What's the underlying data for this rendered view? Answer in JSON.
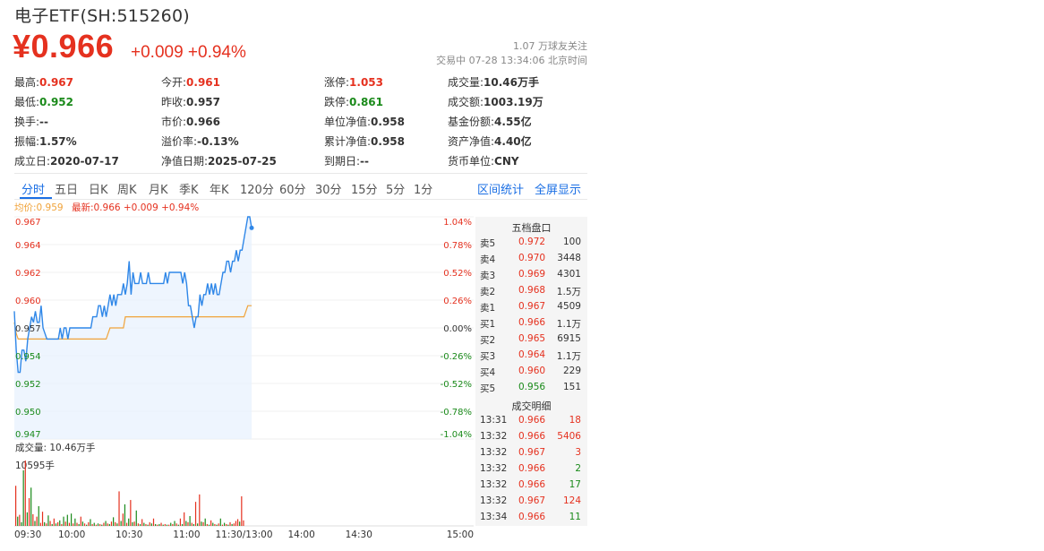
{
  "header": {
    "title": "电子ETF(SH:515260)",
    "price": "¥0.966",
    "change": "+0.009 +0.94%",
    "followers": "1.07 万球友关注",
    "status_time": "交易中 07-28 13:34:06 北京时间"
  },
  "stats": [
    {
      "label": "最高:",
      "value": "0.967",
      "color": "red"
    },
    {
      "label": "今开:",
      "value": "0.961",
      "color": "red"
    },
    {
      "label": "涨停:",
      "value": "1.053",
      "color": "red"
    },
    {
      "label": "成交量:",
      "value": "10.46万手",
      "color": ""
    },
    {
      "label": "最低:",
      "value": "0.952",
      "color": "green"
    },
    {
      "label": "昨收:",
      "value": "0.957",
      "color": ""
    },
    {
      "label": "跌停:",
      "value": "0.861",
      "color": "green"
    },
    {
      "label": "成交额:",
      "value": "1003.19万",
      "color": ""
    },
    {
      "label": "换手:",
      "value": "--",
      "color": ""
    },
    {
      "label": "市价:",
      "value": "0.966",
      "color": ""
    },
    {
      "label": "单位净值:",
      "value": "0.958",
      "color": ""
    },
    {
      "label": "基金份额:",
      "value": "4.55亿",
      "color": ""
    },
    {
      "label": "振幅:",
      "value": "1.57%",
      "color": ""
    },
    {
      "label": "溢价率:",
      "value": "-0.13%",
      "color": ""
    },
    {
      "label": "累计净值:",
      "value": "0.958",
      "color": ""
    },
    {
      "label": "资产净值:",
      "value": "4.40亿",
      "color": ""
    },
    {
      "label": "成立日:",
      "value": "2020-07-17",
      "color": ""
    },
    {
      "label": "净值日期:",
      "value": "2025-07-25",
      "color": ""
    },
    {
      "label": "到期日:",
      "value": "--",
      "color": ""
    },
    {
      "label": "货币单位:",
      "value": "CNY",
      "color": ""
    }
  ],
  "tabs": [
    "分时",
    "五日",
    "日K",
    "周K",
    "月K",
    "季K",
    "年K",
    "120分",
    "60分",
    "30分",
    "15分",
    "5分",
    "1分"
  ],
  "active_tab": "分时",
  "right_links": [
    "区间统计",
    "全屏显示"
  ],
  "legend": {
    "avg_label": "均价:0.959",
    "latest_label": "最新:0.966 +0.009 +0.94%"
  },
  "volume_panel": {
    "title": "成交量: 10.46万手",
    "max_label": "10595手"
  },
  "chart_data": {
    "type": "line",
    "prev_close": 0.957,
    "ylim": [
      0.947,
      0.967
    ],
    "y_ticks_left": [
      "0.967",
      "0.964",
      "0.962",
      "0.960",
      "0.957",
      "0.954",
      "0.952",
      "0.950",
      "0.947"
    ],
    "y_ticks_right": [
      "1.04%",
      "0.78%",
      "0.52%",
      "0.26%",
      "0.00%",
      "-0.26%",
      "-0.52%",
      "-0.78%",
      "-1.04%"
    ],
    "x_ticks": [
      "09:30",
      "10:00",
      "10:30",
      "11:00",
      "11:30/13:00",
      "14:00",
      "14:30",
      "15:00"
    ],
    "total_minutes": 240,
    "price_series": [
      0.9585,
      0.955,
      0.953,
      0.953,
      0.955,
      0.955,
      0.954,
      0.956,
      0.957,
      0.958,
      0.9575,
      0.9585,
      0.9575,
      0.9575,
      0.959,
      0.957,
      0.9565,
      0.956,
      0.956,
      0.956,
      0.956,
      0.956,
      0.956,
      0.956,
      0.957,
      0.956,
      0.957,
      0.957,
      0.956,
      0.957,
      0.957,
      0.957,
      0.957,
      0.957,
      0.957,
      0.957,
      0.957,
      0.957,
      0.957,
      0.957,
      0.957,
      0.958,
      0.958,
      0.958,
      0.959,
      0.959,
      0.958,
      0.959,
      0.958,
      0.959,
      0.96,
      0.959,
      0.96,
      0.959,
      0.96,
      0.96,
      0.96,
      0.961,
      0.96,
      0.961,
      0.963,
      0.96,
      0.962,
      0.961,
      0.961,
      0.961,
      0.962,
      0.961,
      0.961,
      0.961,
      0.962,
      0.961,
      0.961,
      0.961,
      0.961,
      0.961,
      0.961,
      0.961,
      0.961,
      0.962,
      0.961,
      0.962,
      0.962,
      0.962,
      0.962,
      0.962,
      0.962,
      0.962,
      0.961,
      0.962,
      0.961,
      0.959,
      0.959,
      0.958,
      0.957,
      0.958,
      0.958,
      0.96,
      0.959,
      0.96,
      0.96,
      0.961,
      0.96,
      0.961,
      0.96,
      0.961,
      0.96,
      0.96,
      0.961,
      0.962,
      0.962,
      0.963,
      0.963,
      0.962,
      0.963,
      0.963,
      0.964,
      0.963,
      0.964,
      0.964,
      0.965,
      0.966,
      0.967,
      0.967,
      0.966
    ],
    "avg_series": [
      0.9575,
      0.9565,
      0.956,
      0.956,
      0.956,
      0.956,
      0.956,
      0.956,
      0.956,
      0.956,
      0.956,
      0.956,
      0.956,
      0.956,
      0.956,
      0.956,
      0.956,
      0.956,
      0.956,
      0.956,
      0.956,
      0.956,
      0.956,
      0.956,
      0.956,
      0.956,
      0.956,
      0.956,
      0.956,
      0.956,
      0.956,
      0.956,
      0.956,
      0.956,
      0.956,
      0.956,
      0.956,
      0.956,
      0.956,
      0.956,
      0.956,
      0.956,
      0.956,
      0.956,
      0.956,
      0.956,
      0.956,
      0.956,
      0.956,
      0.9565,
      0.957,
      0.957,
      0.957,
      0.957,
      0.957,
      0.957,
      0.957,
      0.957,
      0.958,
      0.958,
      0.958,
      0.958,
      0.958,
      0.958,
      0.958,
      0.958,
      0.958,
      0.958,
      0.958,
      0.958,
      0.958,
      0.958,
      0.958,
      0.958,
      0.958,
      0.958,
      0.958,
      0.958,
      0.958,
      0.958,
      0.958,
      0.958,
      0.958,
      0.958,
      0.958,
      0.958,
      0.958,
      0.958,
      0.958,
      0.958,
      0.958,
      0.958,
      0.958,
      0.958,
      0.958,
      0.958,
      0.958,
      0.958,
      0.958,
      0.958,
      0.958,
      0.958,
      0.958,
      0.958,
      0.958,
      0.958,
      0.958,
      0.958,
      0.958,
      0.958,
      0.958,
      0.958,
      0.958,
      0.958,
      0.958,
      0.958,
      0.958,
      0.958,
      0.958,
      0.958,
      0.958,
      0.9585,
      0.959,
      0.959,
      0.959
    ],
    "volume_max": 10595,
    "volumes": [
      {
        "v": 6500,
        "up": true
      },
      {
        "v": 1500,
        "up": false
      },
      {
        "v": 1800,
        "up": true
      },
      {
        "v": 600,
        "up": false
      },
      {
        "v": 9000,
        "up": false
      },
      {
        "v": 10595,
        "up": true
      },
      {
        "v": 2200,
        "up": false
      },
      {
        "v": 4500,
        "up": true
      },
      {
        "v": 6200,
        "up": false
      },
      {
        "v": 1900,
        "up": true
      },
      {
        "v": 800,
        "up": false
      },
      {
        "v": 1500,
        "up": true
      },
      {
        "v": 3200,
        "up": false
      },
      {
        "v": 500,
        "up": true
      },
      {
        "v": 2300,
        "up": true
      },
      {
        "v": 600,
        "up": false
      },
      {
        "v": 400,
        "up": true
      },
      {
        "v": 1700,
        "up": false
      },
      {
        "v": 800,
        "up": true
      },
      {
        "v": 300,
        "up": false
      },
      {
        "v": 1200,
        "up": true
      },
      {
        "v": 400,
        "up": false
      },
      {
        "v": 600,
        "up": true
      },
      {
        "v": 900,
        "up": false
      },
      {
        "v": 300,
        "up": true
      },
      {
        "v": 1500,
        "up": false
      },
      {
        "v": 700,
        "up": true
      },
      {
        "v": 1800,
        "up": false
      },
      {
        "v": 500,
        "up": true
      },
      {
        "v": 2000,
        "up": false
      },
      {
        "v": 400,
        "up": true
      },
      {
        "v": 1200,
        "up": false
      },
      {
        "v": 500,
        "up": true
      },
      {
        "v": 300,
        "up": false
      },
      {
        "v": 1500,
        "up": true
      },
      {
        "v": 700,
        "up": false
      },
      {
        "v": 400,
        "up": true
      },
      {
        "v": 200,
        "up": false
      },
      {
        "v": 600,
        "up": true
      },
      {
        "v": 1100,
        "up": false
      },
      {
        "v": 300,
        "up": true
      },
      {
        "v": 500,
        "up": false
      },
      {
        "v": 200,
        "up": true
      },
      {
        "v": 400,
        "up": false
      },
      {
        "v": 300,
        "up": true
      },
      {
        "v": 200,
        "up": false
      },
      {
        "v": 500,
        "up": true
      },
      {
        "v": 800,
        "up": false
      },
      {
        "v": 400,
        "up": true
      },
      {
        "v": 300,
        "up": false
      },
      {
        "v": 700,
        "up": true
      },
      {
        "v": 1400,
        "up": false
      },
      {
        "v": 600,
        "up": true
      },
      {
        "v": 400,
        "up": false
      },
      {
        "v": 5600,
        "up": true
      },
      {
        "v": 800,
        "up": false
      },
      {
        "v": 2000,
        "up": true
      },
      {
        "v": 3500,
        "up": false
      },
      {
        "v": 500,
        "up": true
      },
      {
        "v": 1200,
        "up": false
      },
      {
        "v": 4200,
        "up": true
      },
      {
        "v": 600,
        "up": false
      },
      {
        "v": 700,
        "up": true
      },
      {
        "v": 2500,
        "up": false
      },
      {
        "v": 400,
        "up": true
      },
      {
        "v": 300,
        "up": false
      },
      {
        "v": 1100,
        "up": true
      },
      {
        "v": 500,
        "up": false
      },
      {
        "v": 300,
        "up": true
      },
      {
        "v": 200,
        "up": false
      },
      {
        "v": 600,
        "up": true
      },
      {
        "v": 400,
        "up": false
      },
      {
        "v": 1200,
        "up": true
      },
      {
        "v": 300,
        "up": false
      },
      {
        "v": 200,
        "up": true
      },
      {
        "v": 300,
        "up": false
      },
      {
        "v": 500,
        "up": true
      },
      {
        "v": 200,
        "up": false
      },
      {
        "v": 300,
        "up": true
      },
      {
        "v": 200,
        "up": false
      },
      {
        "v": 200,
        "up": true
      },
      {
        "v": 500,
        "up": false
      },
      {
        "v": 300,
        "up": true
      },
      {
        "v": 800,
        "up": false
      },
      {
        "v": 400,
        "up": true
      },
      {
        "v": 200,
        "up": false
      },
      {
        "v": 1200,
        "up": true
      },
      {
        "v": 300,
        "up": false
      },
      {
        "v": 2200,
        "up": true
      },
      {
        "v": 800,
        "up": false
      },
      {
        "v": 600,
        "up": true
      },
      {
        "v": 1600,
        "up": false
      },
      {
        "v": 500,
        "up": true
      },
      {
        "v": 300,
        "up": false
      },
      {
        "v": 3900,
        "up": true
      },
      {
        "v": 400,
        "up": false
      },
      {
        "v": 5100,
        "up": true
      },
      {
        "v": 700,
        "up": false
      },
      {
        "v": 600,
        "up": true
      },
      {
        "v": 1200,
        "up": false
      },
      {
        "v": 300,
        "up": true
      },
      {
        "v": 200,
        "up": false
      },
      {
        "v": 900,
        "up": true
      },
      {
        "v": 500,
        "up": false
      },
      {
        "v": 300,
        "up": true
      },
      {
        "v": 200,
        "up": false
      },
      {
        "v": 400,
        "up": true
      },
      {
        "v": 1200,
        "up": false
      },
      {
        "v": 200,
        "up": true
      },
      {
        "v": 500,
        "up": false
      },
      {
        "v": 300,
        "up": true
      },
      {
        "v": 200,
        "up": false
      },
      {
        "v": 600,
        "up": true
      },
      {
        "v": 300,
        "up": false
      },
      {
        "v": 400,
        "up": true
      },
      {
        "v": 800,
        "up": true
      },
      {
        "v": 1100,
        "up": true
      },
      {
        "v": 700,
        "up": false
      },
      {
        "v": 4800,
        "up": true
      },
      {
        "v": 900,
        "up": true
      }
    ]
  },
  "order_book": {
    "title": "五档盘口",
    "rows": [
      {
        "label": "卖5",
        "price": "0.972",
        "vol": "100",
        "pcolor": "red",
        "vcolor": ""
      },
      {
        "label": "卖4",
        "price": "0.970",
        "vol": "3448",
        "pcolor": "red",
        "vcolor": ""
      },
      {
        "label": "卖3",
        "price": "0.969",
        "vol": "4301",
        "pcolor": "red",
        "vcolor": ""
      },
      {
        "label": "卖2",
        "price": "0.968",
        "vol": "1.5万",
        "pcolor": "red",
        "vcolor": ""
      },
      {
        "label": "卖1",
        "price": "0.967",
        "vol": "4509",
        "pcolor": "red",
        "vcolor": ""
      },
      {
        "label": "买1",
        "price": "0.966",
        "vol": "1.1万",
        "pcolor": "red",
        "vcolor": ""
      },
      {
        "label": "买2",
        "price": "0.965",
        "vol": "6915",
        "pcolor": "red",
        "vcolor": ""
      },
      {
        "label": "买3",
        "price": "0.964",
        "vol": "1.1万",
        "pcolor": "red",
        "vcolor": ""
      },
      {
        "label": "买4",
        "price": "0.960",
        "vol": "229",
        "pcolor": "red",
        "vcolor": ""
      },
      {
        "label": "买5",
        "price": "0.956",
        "vol": "151",
        "pcolor": "green",
        "vcolor": ""
      }
    ]
  },
  "trades": {
    "title": "成交明细",
    "rows": [
      {
        "time": "13:31",
        "price": "0.966",
        "vol": "18",
        "vcolor": "red"
      },
      {
        "time": "13:32",
        "price": "0.966",
        "vol": "5406",
        "vcolor": "red"
      },
      {
        "time": "13:32",
        "price": "0.967",
        "vol": "3",
        "vcolor": "red"
      },
      {
        "time": "13:32",
        "price": "0.966",
        "vol": "2",
        "vcolor": "green"
      },
      {
        "time": "13:32",
        "price": "0.966",
        "vol": "17",
        "vcolor": "green"
      },
      {
        "time": "13:32",
        "price": "0.967",
        "vol": "124",
        "vcolor": "red"
      },
      {
        "time": "13:34",
        "price": "0.966",
        "vol": "11",
        "vcolor": "green"
      }
    ]
  },
  "colors": {
    "up": "#e5311f",
    "down": "#1a8a1a",
    "price_line": "#2f87e8",
    "avg_line": "#f0a33a",
    "link": "#1b6fe4"
  }
}
